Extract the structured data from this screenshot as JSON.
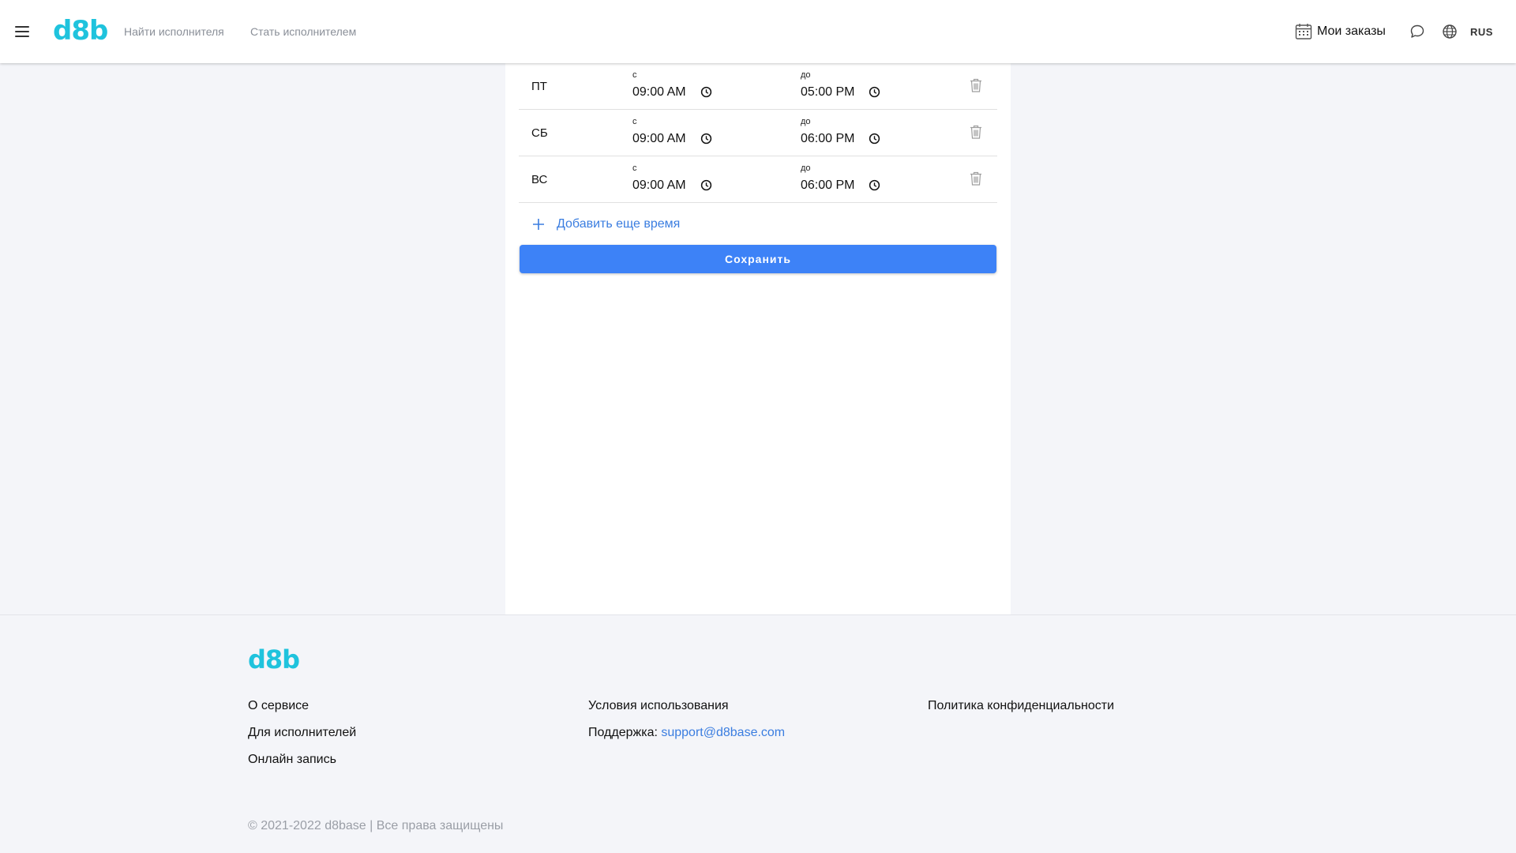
{
  "header": {
    "logo": "d8b",
    "nav": [
      "Найти исполнителя",
      "Стать исполнителем"
    ],
    "orders_label": "Мои заказы",
    "language": "RUS"
  },
  "schedule": {
    "from_label": "с",
    "to_label": "до",
    "rows": [
      {
        "day": "ПТ",
        "from": "09:00  AM",
        "to": "05:00  PM"
      },
      {
        "day": "СБ",
        "from": "09:00  AM",
        "to": "06:00  PM"
      },
      {
        "day": "ВС",
        "from": "09:00  AM",
        "to": "06:00  PM"
      }
    ],
    "add_time_label": "Добавить еще время",
    "save_label": "Сохранить"
  },
  "footer": {
    "logo": "d8b",
    "about": "О сервисе",
    "for_performers": "Для исполнителей",
    "online_booking": "Онлайн запись",
    "terms": "Условия использования",
    "support_label": "Поддержка: ",
    "support_email": "support@d8base.com",
    "privacy": "Политика конфиденциальности",
    "copyright": "© 2021-2022 d8base | Все права защищены"
  },
  "colors": {
    "brand": "#1fc3dd",
    "primary": "#3d82f7",
    "link": "#3a7de0"
  }
}
